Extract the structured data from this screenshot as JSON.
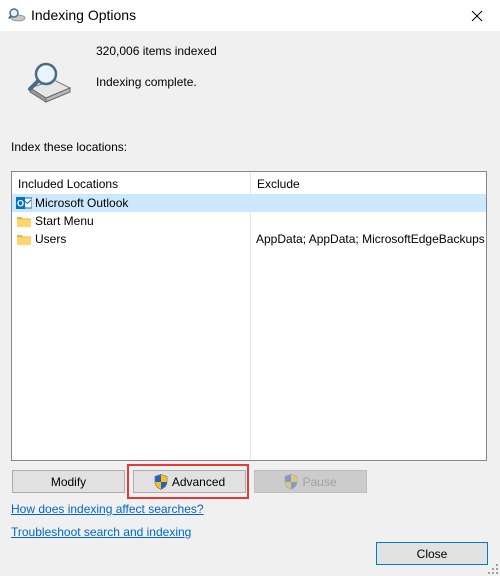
{
  "window": {
    "title": "Indexing Options"
  },
  "summary": {
    "items_indexed": "320,006 items indexed",
    "status": "Indexing complete."
  },
  "locations_label": "Index these locations:",
  "table": {
    "columns": [
      "Included Locations",
      "Exclude"
    ],
    "rows": [
      {
        "name": "Microsoft Outlook",
        "exclude": "",
        "icon": "outlook-icon",
        "selected": true
      },
      {
        "name": "Start Menu",
        "exclude": "",
        "icon": "folder-icon",
        "selected": false
      },
      {
        "name": "Users",
        "exclude": "AppData; AppData; MicrosoftEdgeBackups",
        "icon": "folder-icon",
        "selected": false
      }
    ]
  },
  "buttons": {
    "modify": "Modify",
    "advanced": "Advanced",
    "pause": "Pause",
    "close": "Close"
  },
  "links": {
    "affect_searches": "How does indexing affect searches?",
    "troubleshoot": "Troubleshoot search and indexing"
  },
  "colors": {
    "selection": "#cce8ff",
    "link": "#0066cc",
    "highlight": "#e53935",
    "accent": "#0078d7"
  }
}
